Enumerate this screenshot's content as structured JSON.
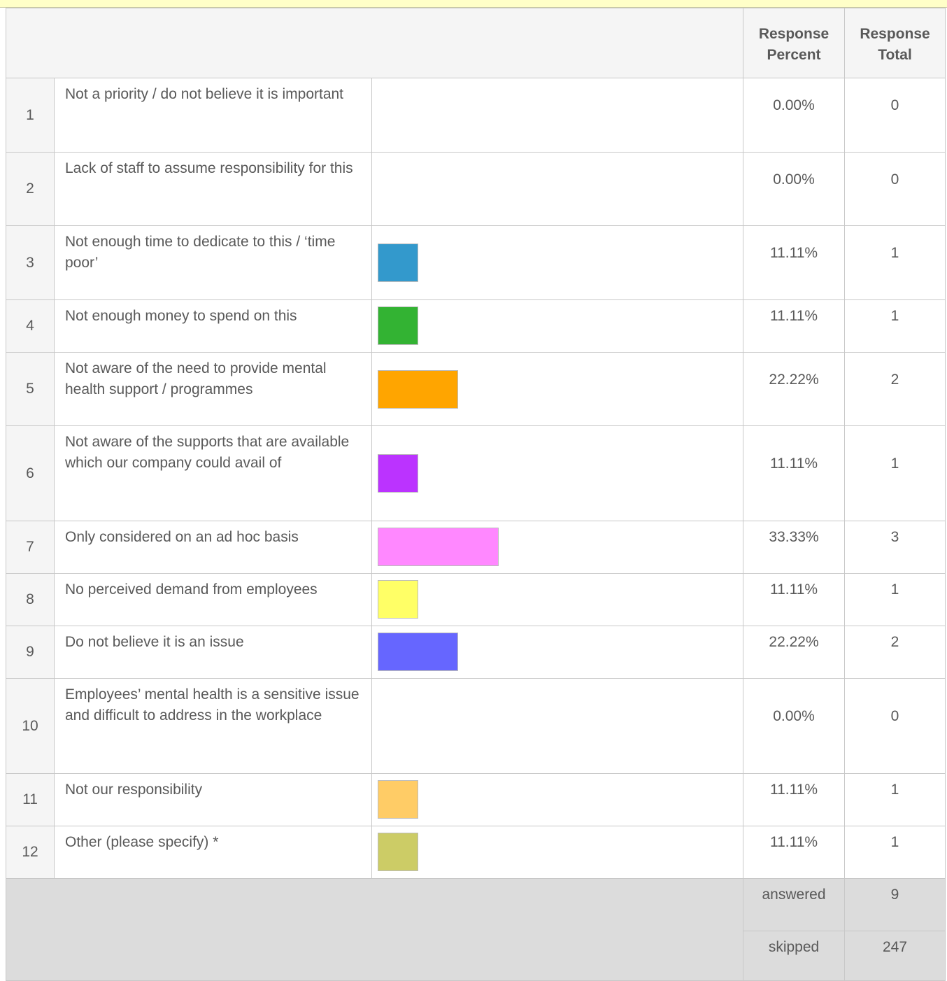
{
  "header": {
    "percent_label": "Response Percent",
    "total_label": "Response Total"
  },
  "chart_data": {
    "type": "bar",
    "categories": [
      "Not a priority / do not believe it is important",
      "Lack of staff to assume responsibility for this",
      "Not enough time to dedicate to this / ‘time poor’",
      "Not enough money to spend on this",
      "Not aware of the need to provide mental health support / programmes",
      "Not aware of the supports that are available which our company could avail of",
      "Only considered on an ad hoc basis",
      "No perceived demand from employees",
      "Do not believe it is an issue",
      "Employees’ mental health is a sensitive issue and difficult to address in the workplace",
      "Not our responsibility",
      "Other (please specify) *"
    ],
    "values": [
      0.0,
      0.0,
      11.11,
      11.11,
      22.22,
      11.11,
      33.33,
      11.11,
      22.22,
      0.0,
      11.11,
      11.11
    ],
    "totals": [
      0,
      0,
      1,
      1,
      2,
      1,
      3,
      1,
      2,
      0,
      1,
      1
    ],
    "colors": [
      "#3399cc",
      "#33b333",
      "#ffa500",
      "#bb33ff",
      "#ff88ff",
      "#ffff66",
      "#6666ff",
      "#ffcc66",
      "#cccc66"
    ],
    "xlim": [
      0,
      100
    ]
  },
  "rows": [
    {
      "num": "1",
      "label": "Not a priority / do not believe it is important",
      "percent": "0.00%",
      "total": "0",
      "color": "#3399cc"
    },
    {
      "num": "2",
      "label": "Lack of staff to assume responsibility for this",
      "percent": "0.00%",
      "total": "0",
      "color": "#33b333"
    },
    {
      "num": "3",
      "label": "Not enough time to dedicate to this / ‘time poor’",
      "percent": "11.11%",
      "total": "1",
      "color": "#3399cc"
    },
    {
      "num": "4",
      "label": "Not enough money to spend on this",
      "percent": "11.11%",
      "total": "1",
      "color": "#33b333"
    },
    {
      "num": "5",
      "label": "Not aware of the need to provide mental health support / programmes",
      "percent": "22.22%",
      "total": "2",
      "color": "#ffa500"
    },
    {
      "num": "6",
      "label": "Not aware of the supports that are available which our company could avail of",
      "percent": "11.11%",
      "total": "1",
      "color": "#bb33ff"
    },
    {
      "num": "7",
      "label": "Only considered on an ad hoc basis",
      "percent": "33.33%",
      "total": "3",
      "color": "#ff88ff"
    },
    {
      "num": "8",
      "label": "No perceived demand from employees",
      "percent": "11.11%",
      "total": "1",
      "color": "#ffff66"
    },
    {
      "num": "9",
      "label": "Do not believe it is an issue",
      "percent": "22.22%",
      "total": "2",
      "color": "#6666ff"
    },
    {
      "num": "10",
      "label": "Employees’ mental health is a sensitive issue and difficult to address in the workplace",
      "percent": "0.00%",
      "total": "0",
      "color": "#3399cc"
    },
    {
      "num": "11",
      "label": "Not our responsibility",
      "percent": "11.11%",
      "total": "1",
      "color": "#ffcc66"
    },
    {
      "num": "12",
      "label": "Other (please specify) *",
      "percent": "11.11%",
      "total": "1",
      "color": "#cccc66"
    }
  ],
  "summary": {
    "answered_label": "answered",
    "answered_value": "9",
    "skipped_label": "skipped",
    "skipped_value": "247"
  }
}
